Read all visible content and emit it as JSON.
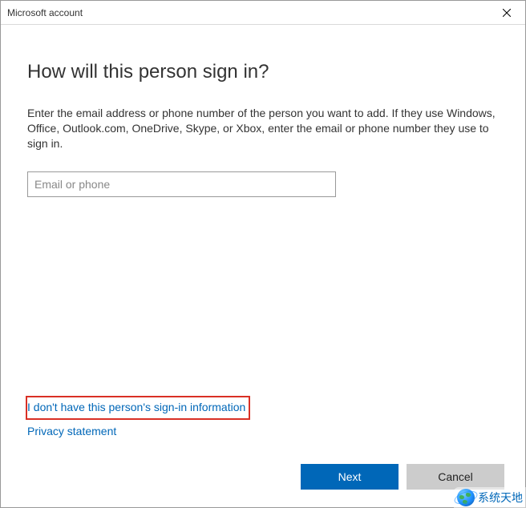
{
  "window": {
    "title": "Microsoft account"
  },
  "content": {
    "heading": "How will this person sign in?",
    "description": "Enter the email address or phone number of the person you want to add. If they use Windows, Office, Outlook.com, OneDrive, Skype, or Xbox, enter the email or phone number they use to sign in.",
    "email_placeholder": "Email or phone",
    "email_value": ""
  },
  "links": {
    "no_info": "I don't have this person's sign-in information",
    "privacy": "Privacy statement"
  },
  "buttons": {
    "next": "Next",
    "cancel": "Cancel"
  },
  "watermark": {
    "text": "系统天地"
  }
}
